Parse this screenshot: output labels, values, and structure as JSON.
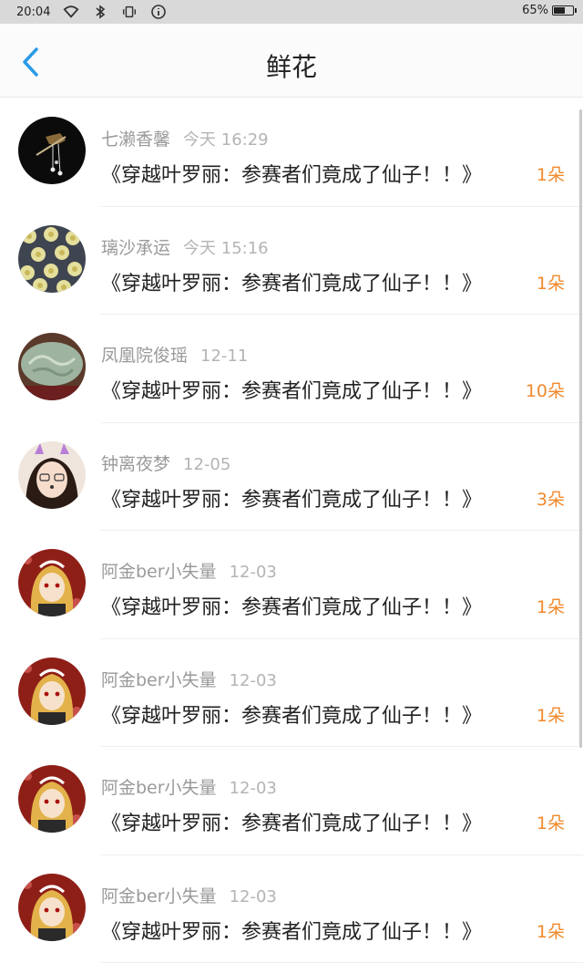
{
  "statusbar": {
    "time": "20:04",
    "battery": "65%",
    "battery_level": 0.65
  },
  "header": {
    "title": "鲜花"
  },
  "colors": {
    "count": "#f08a2c",
    "back": "#2b9be8",
    "muted": "#9a9a9a"
  },
  "items": [
    {
      "name": "七濑香馨",
      "time": "今天 16:29",
      "title": "《穿越叶罗丽：参赛者们竟成了仙子！！》",
      "count": "1朵",
      "avatar": "dark-hairpin"
    },
    {
      "name": "璃沙承运",
      "time": "今天 15:16",
      "title": "《穿越叶罗丽：参赛者们竟成了仙子！！》",
      "count": "1朵",
      "avatar": "floral-pattern"
    },
    {
      "name": "凤凰院俊瑶",
      "time": "12-11",
      "title": "《穿越叶罗丽：参赛者们竟成了仙子！！》",
      "count": "10朵",
      "avatar": "jade-carving"
    },
    {
      "name": "钟离夜梦",
      "time": "12-05",
      "title": "《穿越叶罗丽：参赛者们竟成了仙子！！》",
      "count": "3朵",
      "avatar": "girl-selfie"
    },
    {
      "name": "阿金ber小失量",
      "time": "12-03",
      "title": "《穿越叶罗丽：参赛者们竟成了仙子！！》",
      "count": "1朵",
      "avatar": "anime-girl"
    },
    {
      "name": "阿金ber小失量",
      "time": "12-03",
      "title": "《穿越叶罗丽：参赛者们竟成了仙子！！》",
      "count": "1朵",
      "avatar": "anime-girl"
    },
    {
      "name": "阿金ber小失量",
      "time": "12-03",
      "title": "《穿越叶罗丽：参赛者们竟成了仙子！！》",
      "count": "1朵",
      "avatar": "anime-girl"
    },
    {
      "name": "阿金ber小失量",
      "time": "12-03",
      "title": "《穿越叶罗丽：参赛者们竟成了仙子！！》",
      "count": "1朵",
      "avatar": "anime-girl"
    }
  ]
}
